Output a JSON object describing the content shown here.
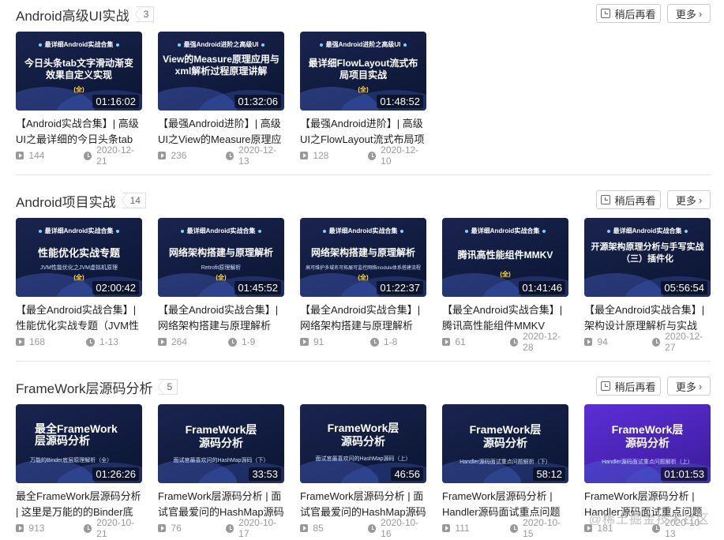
{
  "buttons": {
    "watch_later": "稍后再看",
    "more": "更多"
  },
  "sections": [
    {
      "title": "Android高级UI实战",
      "count": "3",
      "cards": [
        {
          "tag": "最详细Android实战合集",
          "headline": "今日头条tab文字滑动渐变效果自定义实现",
          "sub": "",
          "full": "(全)",
          "duration": "01:16:02",
          "title": "【Android实战合集】| 高级UI之最详细的今日头条tab文字滑动渐变效果自定义实现",
          "plays": "144",
          "date": "2020-12-21"
        },
        {
          "tag": "最强Android进阶之高级UI",
          "headline": "View的Measure原理应用与xml解析过程原理讲解",
          "sub": "",
          "full": "",
          "duration": "01:32:06",
          "title": "【最强Android进阶】| 高级UI之View的Measure原理应用与xml解析过程原理讲解",
          "plays": "236",
          "date": "2020-12-13"
        },
        {
          "tag": "最强Android进阶之高级UI",
          "headline": "最详细FlowLayout流式布局项目实战",
          "sub": "",
          "full": "(全)",
          "duration": "01:48:52",
          "title": "【最强Android进阶】| 高级UI之FlowLayout流式布局项目实战",
          "plays": "128",
          "date": "2020-12-10"
        }
      ]
    },
    {
      "title": "Android项目实战",
      "count": "14",
      "cards": [
        {
          "tag": "最详细Android实战合集",
          "headline": "性能优化实战专题",
          "sub": "JVM性能优化之JVM虚拟机原理",
          "full": "(全)",
          "duration": "02:00:42",
          "title": "【最全Android实战合集】|性能优化实战专题（JVM性能优化之JVM虚拟机原理）",
          "plays": "168",
          "date": "1-13"
        },
        {
          "tag": "最详细Android实战合集",
          "headline": "网络架构搭建与原理解析",
          "sub": "Retrofit原理解析",
          "full": "(全)",
          "duration": "01:45:52",
          "title": "【最全Android实战合集】|网络架构搭建与原理解析",
          "plays": "264",
          "date": "1-9"
        },
        {
          "tag": "最详细Android实战合集",
          "headline": "网络架构搭建与原理解析",
          "sub": "高可维护多域名可拓展可监控网络module体系搭建流程",
          "full": "(全)",
          "duration": "01:22:37",
          "title": "【最全Android实战合集】|网络架构搭建与原理解析（高可维护多域名可拓展）",
          "plays": "91",
          "date": "1-8"
        },
        {
          "tag": "最详细Android实战合集",
          "headline": "腾讯高性能组件MMKV",
          "sub": "",
          "full": "(全)",
          "duration": "01:41:46",
          "title": "【最全Android实战合集】|腾讯高性能组件MMKV",
          "plays": "61",
          "date": "2020-12-28"
        },
        {
          "tag": "最详细Android实战合集",
          "headline": "开源架构原理分析与手写实战（三）插件化",
          "sub": "",
          "full": "",
          "duration": "05:56:54",
          "title": "【最全Android实战合集】|架构设计原理解析与实战",
          "plays": "94",
          "date": "2020-12-27"
        }
      ]
    },
    {
      "title": "FrameWork层源码分析",
      "count": "5",
      "cards": [
        {
          "tag": "",
          "headline": "最全FrameWork层源码分析",
          "sub": "万能的Binder底层原理解析（全）",
          "full": "",
          "duration": "01:26:26",
          "title": "最全FrameWork层源码分析 | 这里是万能的的Binder底层原理解析",
          "plays": "913",
          "date": "2020-10-21"
        },
        {
          "tag": "",
          "headline": "FrameWork层源码分析",
          "sub": "面试官最喜欢问的HashMap源码（下）",
          "full": "",
          "duration": "33:53",
          "title": "FrameWork层源码分析 | 面试官最爱问的HashMap源码（下）",
          "plays": "76",
          "date": "2020-10-17"
        },
        {
          "tag": "",
          "headline": "FrameWork层源码分析",
          "sub": "面试官最喜欢问的HashMap源码（上）",
          "full": "",
          "duration": "46:56",
          "title": "FrameWork层源码分析 | 面试官最爱问的HashMap源码（上）",
          "plays": "85",
          "date": "2020-10-16"
        },
        {
          "tag": "",
          "headline": "FrameWork层源码分析",
          "sub": "Handler源码面试重点问题解析（下）",
          "full": "",
          "duration": "58:12",
          "title": "FrameWork层源码分析 | Handler源码面试重点问题解析（下）",
          "plays": "111",
          "date": "2020-10-15"
        },
        {
          "tag": "",
          "headline": "FrameWork层源码分析",
          "sub": "Handler源码面试重点问题解析（上）",
          "full": "",
          "duration": "01:01:53",
          "title": "FrameWork层源码分析 | Handler源码面试重点问题解析（上）",
          "plays": "181",
          "date": "2020-10-13"
        }
      ]
    }
  ],
  "watermark": "@稀土掘金技术社区"
}
